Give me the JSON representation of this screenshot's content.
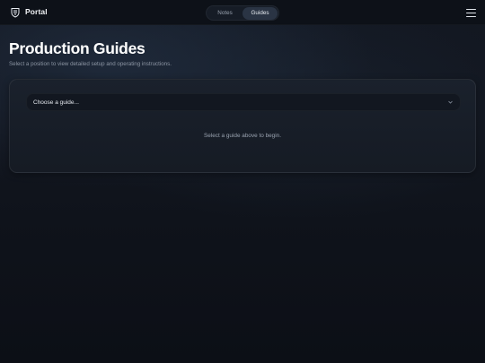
{
  "header": {
    "brand": "Portal",
    "logo_icon": "shield-logo-icon",
    "nav": [
      {
        "label": "Notes",
        "active": false
      },
      {
        "label": "Guides",
        "active": true
      }
    ],
    "menu_icon": "hamburger-menu-icon"
  },
  "main": {
    "title": "Production Guides",
    "subtitle": "Select a position to view detailed setup and operating instructions.",
    "select": {
      "value": "Choose a guide...",
      "icon": "chevron-down-icon"
    },
    "hint": "Select a guide above to begin."
  },
  "colors": {
    "background": "#11151d",
    "header": "#0d1118",
    "card": "#181e28",
    "active_tab": "#2a3444"
  }
}
